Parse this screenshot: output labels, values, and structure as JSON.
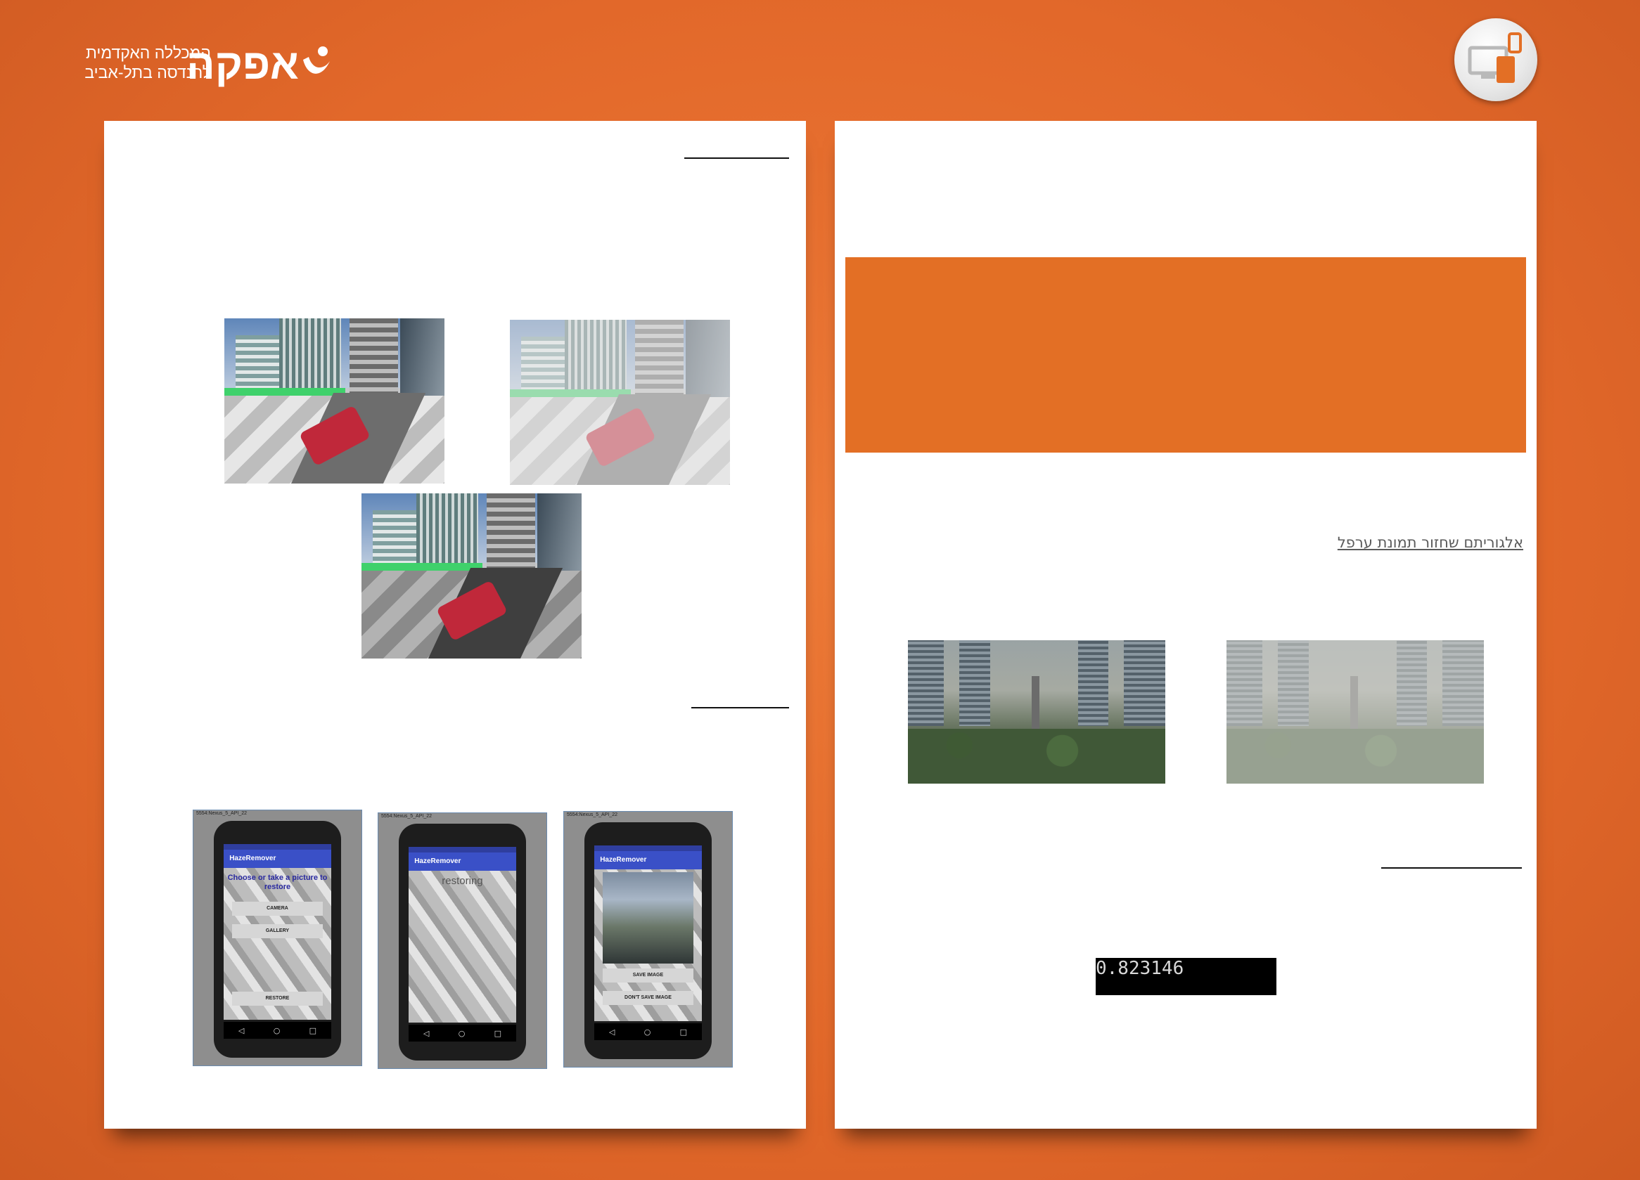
{
  "header": {
    "logo_main": "אפקה",
    "logo_line1": "המכללה האקדמית",
    "logo_line2": "להנדסה בתל-אביב",
    "badge_icon": "devices-icon"
  },
  "left_page": {
    "phones": [
      {
        "window_title": "5554:Nexus_5_API_22",
        "time": "2:28",
        "app_title": "HazeRemover",
        "heading": "Choose or take a picture to restore",
        "buttons": [
          "CAMERA",
          "GALLERY",
          "RESTORE"
        ]
      },
      {
        "window_title": "5554:Nexus_5_API_22",
        "time": "2:29",
        "app_title": "HazeRemover",
        "progress_text": "restoring"
      },
      {
        "window_title": "5554:Nexus_5_API_22",
        "time": "2:30",
        "app_title": "HazeRemover",
        "buttons": [
          "SAVE IMAGE",
          "DON'T SAVE IMAGE"
        ]
      }
    ],
    "nav_back": "◁",
    "nav_home": "○",
    "nav_recent": "□"
  },
  "right_page": {
    "link_text": "אלגוריתם שחזור תמונת ערפל",
    "metric_value": "0.823146"
  },
  "colors": {
    "background": "#e36f25",
    "banner": "#e36f25",
    "app_bar": "#3a50c7"
  }
}
